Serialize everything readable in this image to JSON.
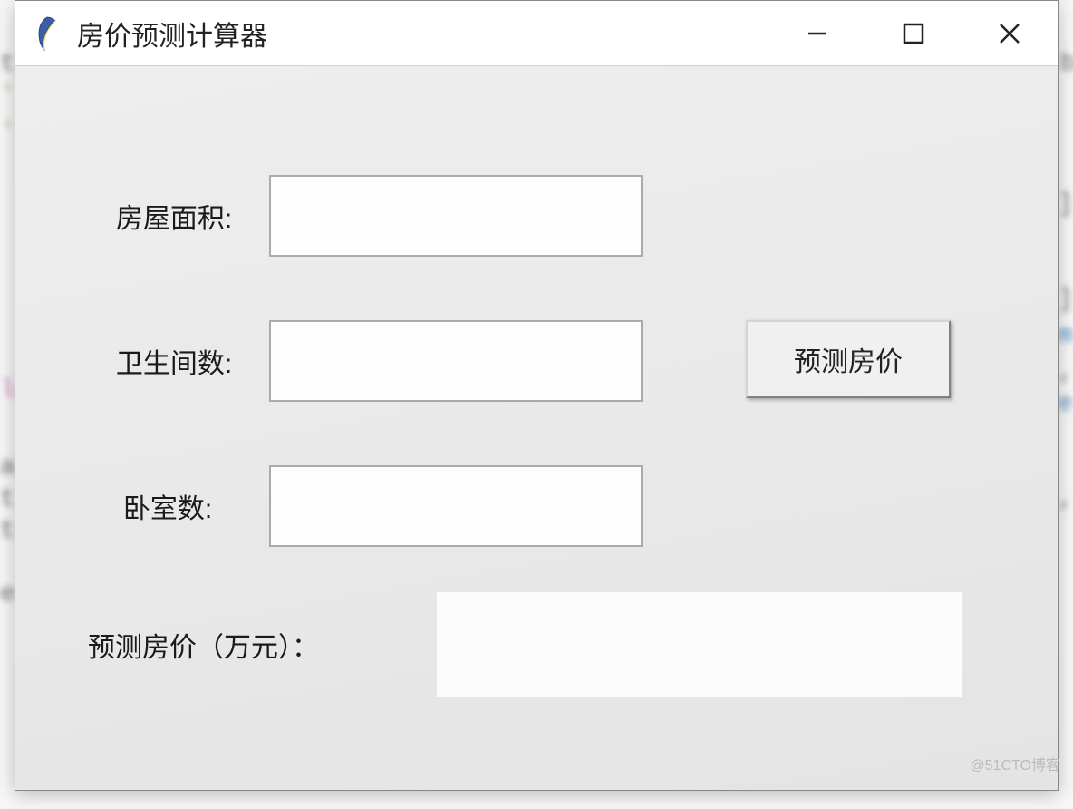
{
  "window": {
    "title": "房价预测计算器"
  },
  "form": {
    "area": {
      "label": "房屋面积:",
      "value": ""
    },
    "bathrooms": {
      "label": "卫生间数:",
      "value": ""
    },
    "bedrooms": {
      "label": "卧室数:",
      "value": ""
    },
    "result": {
      "label": "预测房价（万元）：",
      "value": ""
    }
  },
  "buttons": {
    "predict": "预测房价"
  },
  "watermark": "@51CTO博客"
}
